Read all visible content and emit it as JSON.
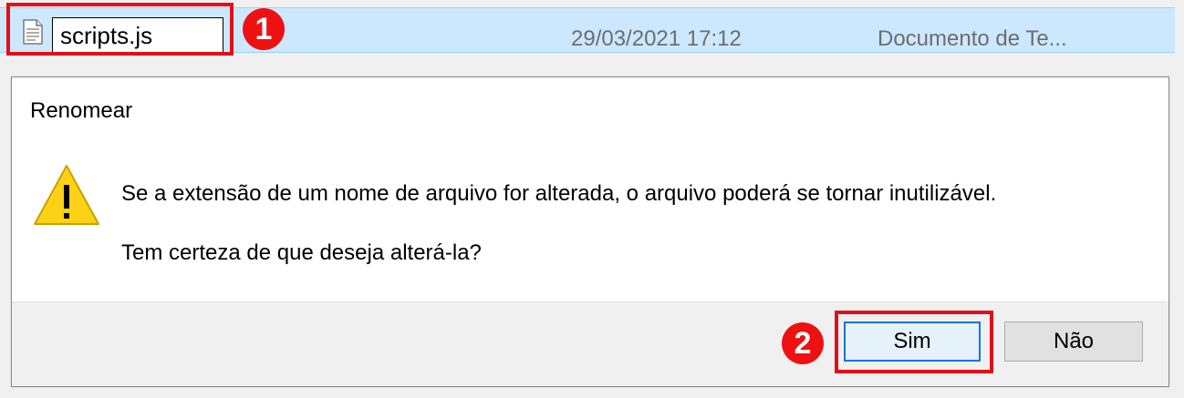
{
  "file_row": {
    "filename": "scripts.js",
    "date_modified": "29/03/2021 17:12",
    "file_type": "Documento de Te..."
  },
  "badges": {
    "step1": "1",
    "step2": "2"
  },
  "dialog": {
    "title": "Renomear",
    "message_line1": "Se a extensão de um nome de arquivo for alterada, o arquivo poderá se tornar inutilizável.",
    "message_line2": "Tem certeza de que deseja alterá-la?",
    "yes_label": "Sim",
    "no_label": "Não",
    "icon": "warning-icon"
  },
  "colors": {
    "selection": "#cce8ff",
    "highlight": "#e0101a",
    "badge": "#ee1111",
    "default_button_border": "#0078d7",
    "warning": "#fcd116"
  }
}
